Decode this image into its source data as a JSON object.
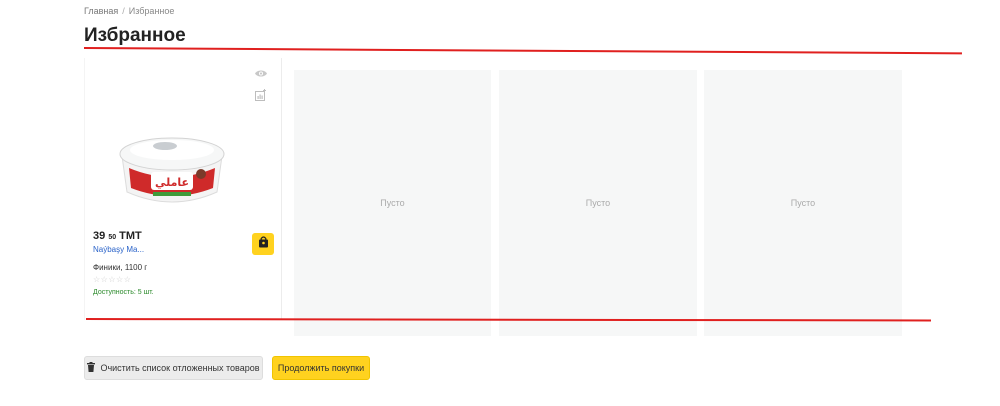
{
  "breadcrumb": {
    "home": "Главная",
    "separator": "/",
    "current": "Избранное"
  },
  "page": {
    "title": "Избранное"
  },
  "product": {
    "price_main": "39",
    "price_cents": "50",
    "currency": "ТМТ",
    "seller": "Naýbaşy Ma...",
    "name": "Финики, 1100 г",
    "stars": "☆☆☆☆☆",
    "stock": "Доступность: 5 шт.",
    "brand_logo_text": "عاملي",
    "icons": {
      "view": "eye-icon",
      "compare": "compare-icon",
      "cart": "shopping-bag-icon"
    }
  },
  "empty_slots": [
    {
      "label": "Пусто"
    },
    {
      "label": "Пусто"
    },
    {
      "label": "Пусто"
    }
  ],
  "actions": {
    "clear_label": "Очистить список отложенных товаров",
    "continue_label": "Продолжить покупки"
  },
  "colors": {
    "accent_yellow": "#ffd21f",
    "annotation_red": "#e0201f",
    "seller_link": "#2a63c9",
    "stock_green": "#2a8a2a"
  }
}
